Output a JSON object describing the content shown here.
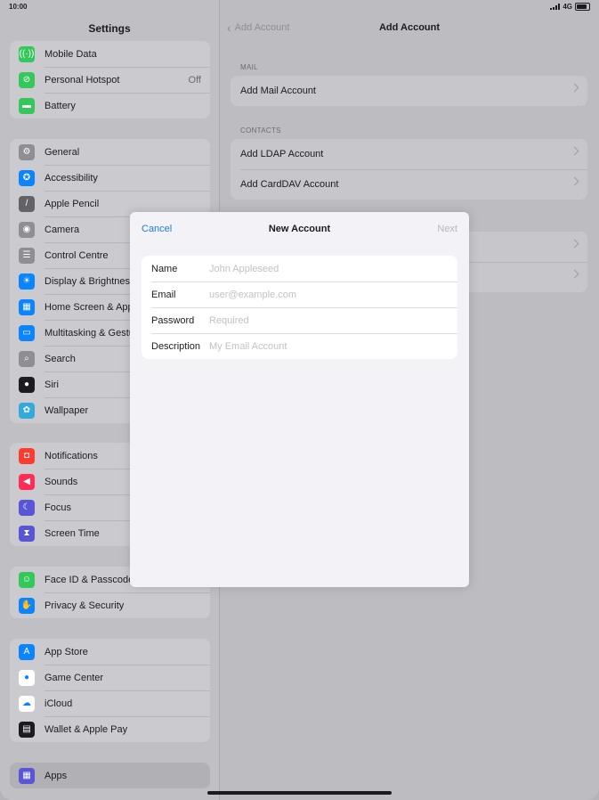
{
  "status": {
    "time": "10:00",
    "network": "4G"
  },
  "settings": {
    "title": "Settings",
    "group1": [
      {
        "label": "Mobile Data",
        "icon": "antenna-icon",
        "color": "#34c759",
        "glyph": "((·))",
        "value": ""
      },
      {
        "label": "Personal Hotspot",
        "icon": "hotspot-link-icon",
        "color": "#34c759",
        "glyph": "⊘",
        "value": "Off"
      },
      {
        "label": "Battery",
        "icon": "battery-icon",
        "color": "#34c759",
        "glyph": "▬",
        "value": ""
      }
    ],
    "group2": [
      {
        "label": "General",
        "icon": "gear-icon",
        "color": "#8e8e93",
        "glyph": "⚙"
      },
      {
        "label": "Accessibility",
        "icon": "accessibility-icon",
        "color": "#0a84ff",
        "glyph": "✪"
      },
      {
        "label": "Apple Pencil",
        "icon": "pencil-icon",
        "color": "#636366",
        "glyph": "/"
      },
      {
        "label": "Camera",
        "icon": "camera-icon",
        "color": "#8e8e93",
        "glyph": "◉"
      },
      {
        "label": "Control Centre",
        "icon": "control-centre-icon",
        "color": "#8e8e93",
        "glyph": "☰"
      },
      {
        "label": "Display & Brightness",
        "icon": "brightness-icon",
        "color": "#0a84ff",
        "glyph": "☀"
      },
      {
        "label": "Home Screen & App Library",
        "icon": "home-screen-icon",
        "color": "#0a84ff",
        "glyph": "▦"
      },
      {
        "label": "Multitasking & Gestures",
        "icon": "multitasking-icon",
        "color": "#0a84ff",
        "glyph": "▭"
      },
      {
        "label": "Search",
        "icon": "search-icon",
        "color": "#8e8e93",
        "glyph": "⌕"
      },
      {
        "label": "Siri",
        "icon": "siri-icon",
        "color": "#1c1c1e",
        "glyph": "●"
      },
      {
        "label": "Wallpaper",
        "icon": "wallpaper-icon",
        "color": "#34aadc",
        "glyph": "✿"
      }
    ],
    "group3": [
      {
        "label": "Notifications",
        "icon": "notifications-icon",
        "color": "#ff3b30",
        "glyph": "◘"
      },
      {
        "label": "Sounds",
        "icon": "speaker-icon",
        "color": "#ff2d55",
        "glyph": "◀"
      },
      {
        "label": "Focus",
        "icon": "moon-icon",
        "color": "#5856d6",
        "glyph": "☾"
      },
      {
        "label": "Screen Time",
        "icon": "hourglass-icon",
        "color": "#5856d6",
        "glyph": "⧗"
      }
    ],
    "group4": [
      {
        "label": "Face ID & Passcode",
        "icon": "face-id-icon",
        "color": "#34c759",
        "glyph": "☺"
      },
      {
        "label": "Privacy & Security",
        "icon": "hand-icon",
        "color": "#0a84ff",
        "glyph": "✋"
      }
    ],
    "group5": [
      {
        "label": "App Store",
        "icon": "app-store-icon",
        "color": "#0a84ff",
        "glyph": "A"
      },
      {
        "label": "Game Center",
        "icon": "game-center-icon",
        "color": "#ffffff",
        "glyph": "●"
      },
      {
        "label": "iCloud",
        "icon": "cloud-icon",
        "color": "#ffffff",
        "glyph": "☁"
      },
      {
        "label": "Wallet & Apple Pay",
        "icon": "wallet-icon",
        "color": "#1c1c1e",
        "glyph": "▤"
      }
    ],
    "group6": [
      {
        "label": "Apps",
        "icon": "apps-grid-icon",
        "color": "#5856d6",
        "glyph": "▦"
      }
    ]
  },
  "add_account": {
    "back_label": "Add Account",
    "title": "Add Account",
    "mail_section": "MAIL",
    "mail_items": [
      "Add Mail Account"
    ],
    "contacts_section": "CONTACTS",
    "contacts_items": [
      "Add LDAP Account",
      "Add CardDAV Account"
    ]
  },
  "modal": {
    "cancel": "Cancel",
    "title": "New Account",
    "next": "Next",
    "fields": [
      {
        "label": "Name",
        "placeholder": "John Appleseed",
        "value": ""
      },
      {
        "label": "Email",
        "placeholder": "user@example.com",
        "value": ""
      },
      {
        "label": "Password",
        "placeholder": "Required",
        "value": ""
      },
      {
        "label": "Description",
        "placeholder": "My Email Account",
        "value": ""
      }
    ]
  }
}
